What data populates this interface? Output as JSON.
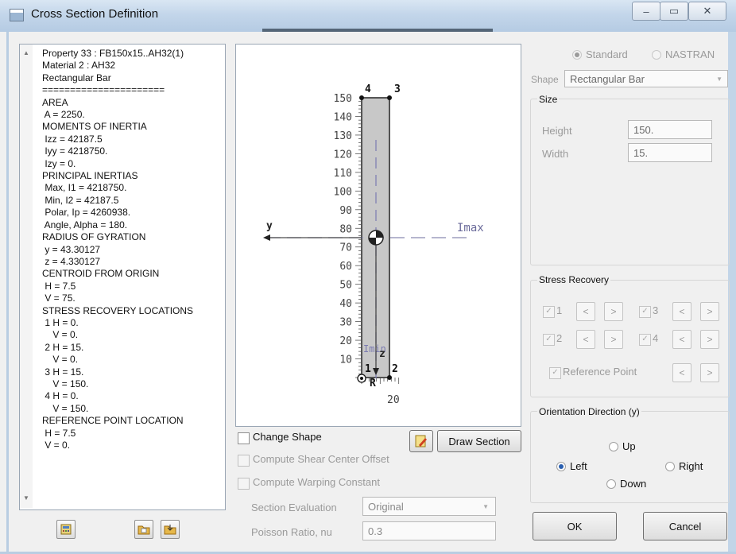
{
  "window": {
    "title": "Cross Section Definition",
    "minimize": "–",
    "maximize": "▭",
    "close": "✕"
  },
  "properties": {
    "lines": [
      "Property 33 : FB150x15..AH32(1)",
      "Material 2 : AH32",
      "Rectangular Bar",
      "======================",
      "AREA",
      " A = 2250.",
      "MOMENTS OF INERTIA",
      " Izz = 42187.5",
      " Iyy = 4218750.",
      " Izy = 0.",
      "PRINCIPAL INERTIAS",
      " Max, I1 = 4218750.",
      " Min, I2 = 42187.5",
      " Polar, Ip = 4260938.",
      " Angle, Alpha = 180.",
      "RADIUS OF GYRATION",
      " y = 43.30127",
      " z = 4.330127",
      "CENTROID FROM ORIGIN",
      " H = 7.5",
      " V = 75.",
      "STRESS RECOVERY LOCATIONS",
      " 1 H = 0.",
      "    V = 0.",
      " 2 H = 15.",
      "    V = 0.",
      " 3 H = 15.",
      "    V = 150.",
      " 4 H = 0.",
      "    V = 150.",
      "REFERENCE POINT LOCATION",
      " H = 7.5",
      " V = 0."
    ]
  },
  "drawing": {
    "y_ticks": [
      "150",
      "140",
      "130",
      "120",
      "110",
      "100",
      "90",
      "80",
      "70",
      "60",
      "50",
      "40",
      "30",
      "20",
      "10"
    ],
    "x_tick": "20",
    "corners": [
      "1",
      "2",
      "3",
      "4"
    ],
    "axis_y": "y",
    "axis_z": "z",
    "imax": "Imax",
    "imin": "Imin",
    "ref_label": "R"
  },
  "options": {
    "change_shape": "Change Shape",
    "shear_center": "Compute Shear Center Offset",
    "warping": "Compute Warping Constant",
    "section_evaluation_label": "Section Evaluation",
    "section_evaluation_value": "Original",
    "poisson_label": "Poisson Ratio, nu",
    "poisson_value": "0.3",
    "draw_section": "Draw Section"
  },
  "right": {
    "standard": "Standard",
    "nastran": "NASTRAN",
    "shape_label": "Shape",
    "shape_value": "Rectangular Bar",
    "size_title": "Size",
    "height_label": "Height",
    "height_value": "150.",
    "width_label": "Width",
    "width_value": "15.",
    "stress_title": "Stress Recovery",
    "stress_points": [
      "1",
      "2",
      "3",
      "4"
    ],
    "prev": "<",
    "next": ">",
    "reference_point": "Reference Point",
    "orientation_title": "Orientation Direction (y)",
    "up": "Up",
    "left": "Left",
    "right": "Right",
    "down": "Down",
    "ok": "OK",
    "cancel": "Cancel"
  }
}
